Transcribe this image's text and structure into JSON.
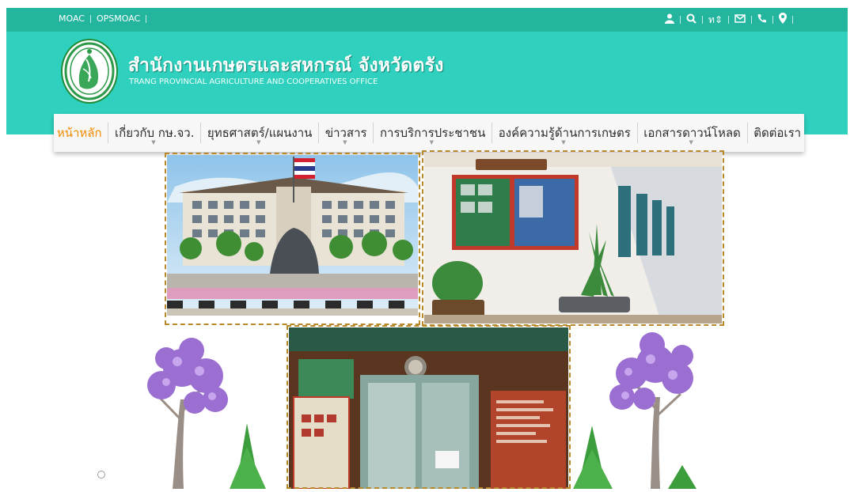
{
  "topbar": {
    "links": [
      "MOAC",
      "OPSMOAC"
    ],
    "tools": [
      {
        "name": "user-icon",
        "glyph": "👤"
      },
      {
        "name": "search-icon",
        "glyph": "🔍"
      },
      {
        "name": "language-switch",
        "glyph": "ท⇕"
      },
      {
        "name": "mail-icon",
        "glyph": "✉"
      },
      {
        "name": "phone-icon",
        "glyph": "☎"
      },
      {
        "name": "map-marker-icon",
        "glyph": "📍"
      }
    ]
  },
  "header": {
    "title": "สำนักงานเกษตรและสหกรณ์ จังหวัดตรัง",
    "subtitle": "TRANG PROVINCIAL AGRICULTURE AND COOPERATIVES OFFICE"
  },
  "nav": {
    "items": [
      {
        "label": "หน้าหลัก",
        "active": true,
        "dropdown": false
      },
      {
        "label": "เกี่ยวกับ กษ.จว.",
        "active": false,
        "dropdown": true
      },
      {
        "label": "ยุทธศาสตร์/แผนงาน",
        "active": false,
        "dropdown": true
      },
      {
        "label": "ข่าวสาร",
        "active": false,
        "dropdown": true
      },
      {
        "label": "การบริการประชาชน",
        "active": false,
        "dropdown": true
      },
      {
        "label": "องค์ความรู้ด้านการเกษตร",
        "active": false,
        "dropdown": true
      },
      {
        "label": "เอกสารดาวน์โหลด",
        "active": false,
        "dropdown": true
      },
      {
        "label": "ติดต่อเรา",
        "active": false,
        "dropdown": false
      }
    ]
  },
  "colors": {
    "topbar": "#24b59f",
    "header": "#2fd0bd",
    "nav_active": "#f08a00"
  }
}
